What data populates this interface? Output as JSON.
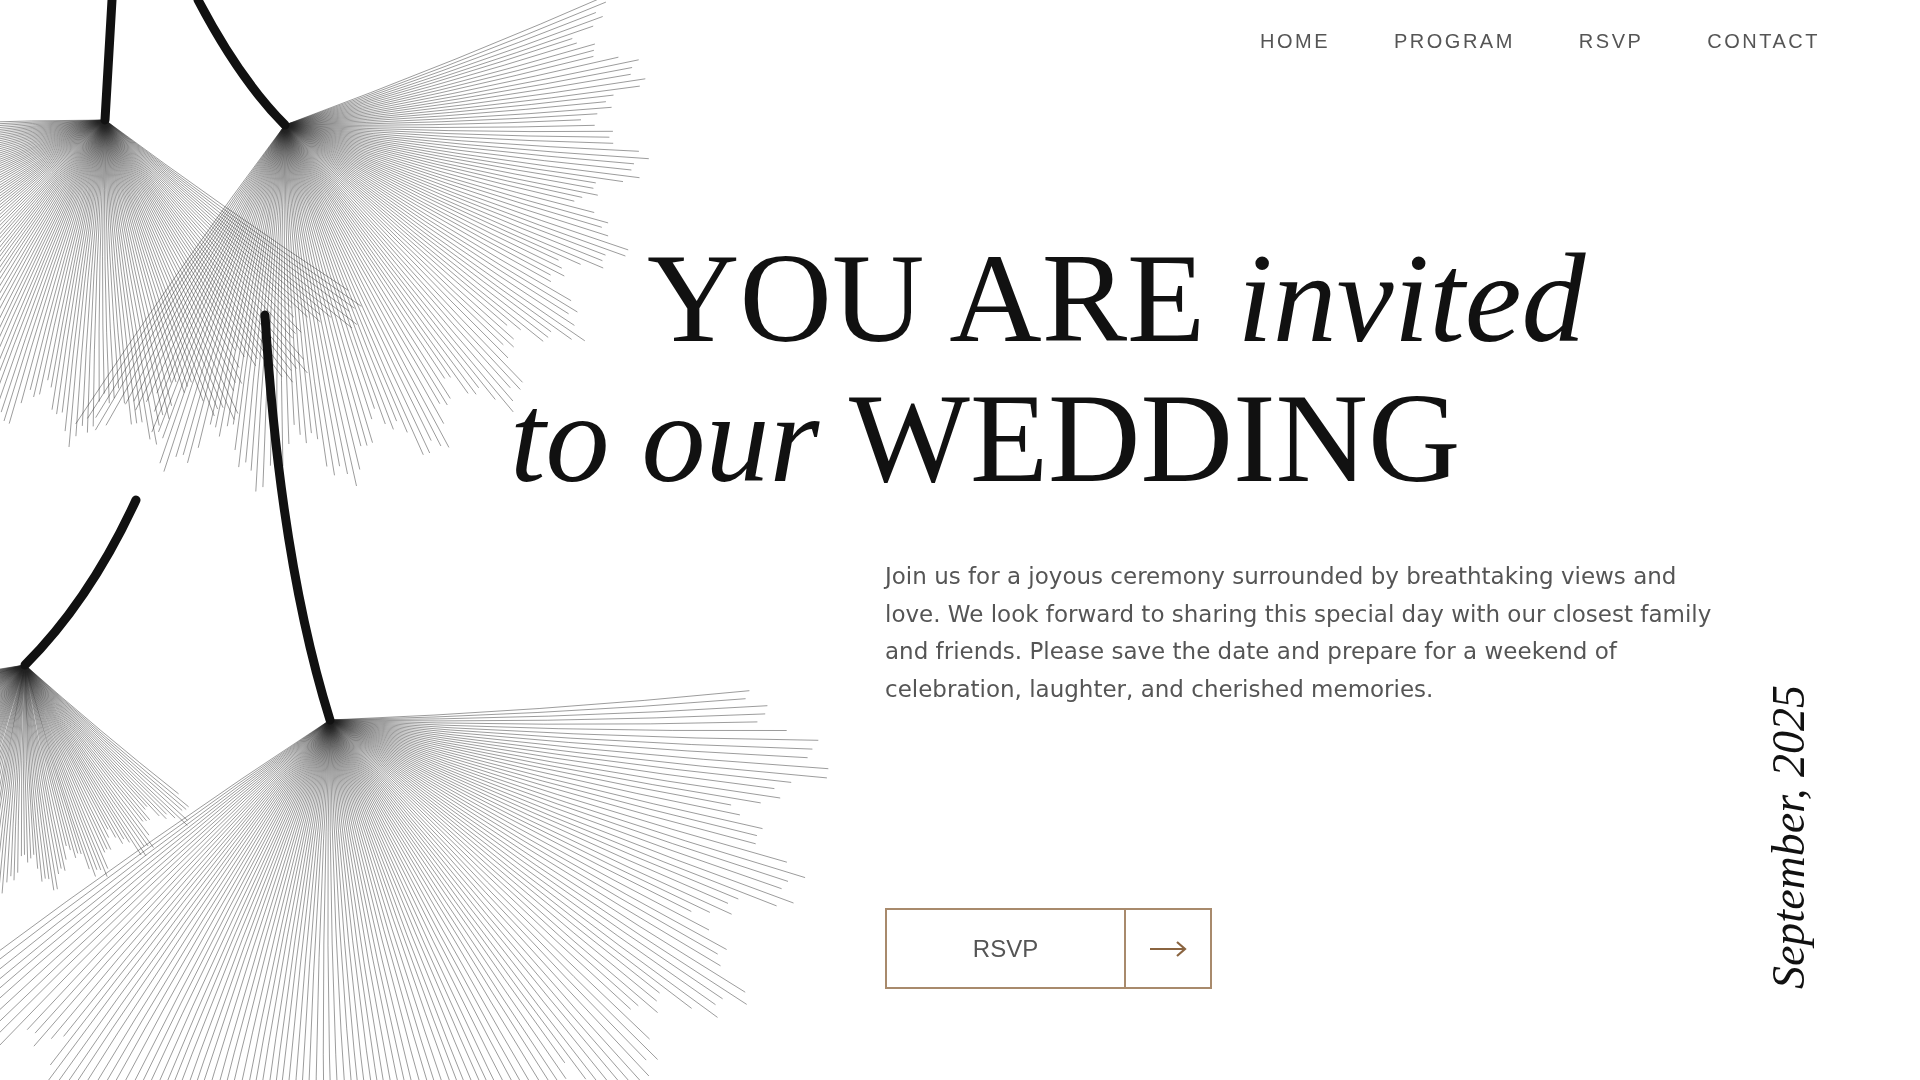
{
  "nav": [
    {
      "label": "HOME"
    },
    {
      "label": "PROGRAM"
    },
    {
      "label": "RSVP"
    },
    {
      "label": "CONTACT"
    }
  ],
  "heading": [
    "YOU ARE *invited*",
    "*to our* WEDDING"
  ],
  "intro": "Join us for a joyous ceremony surrounded by breathtaking views and love. We look forward to sharing this special day with our closest family and friends. Please save the date and prepare for a weekend of celebration, laughter, and cherished memories.",
  "cta": {
    "label": "RSVP"
  },
  "date": "September, 2025"
}
